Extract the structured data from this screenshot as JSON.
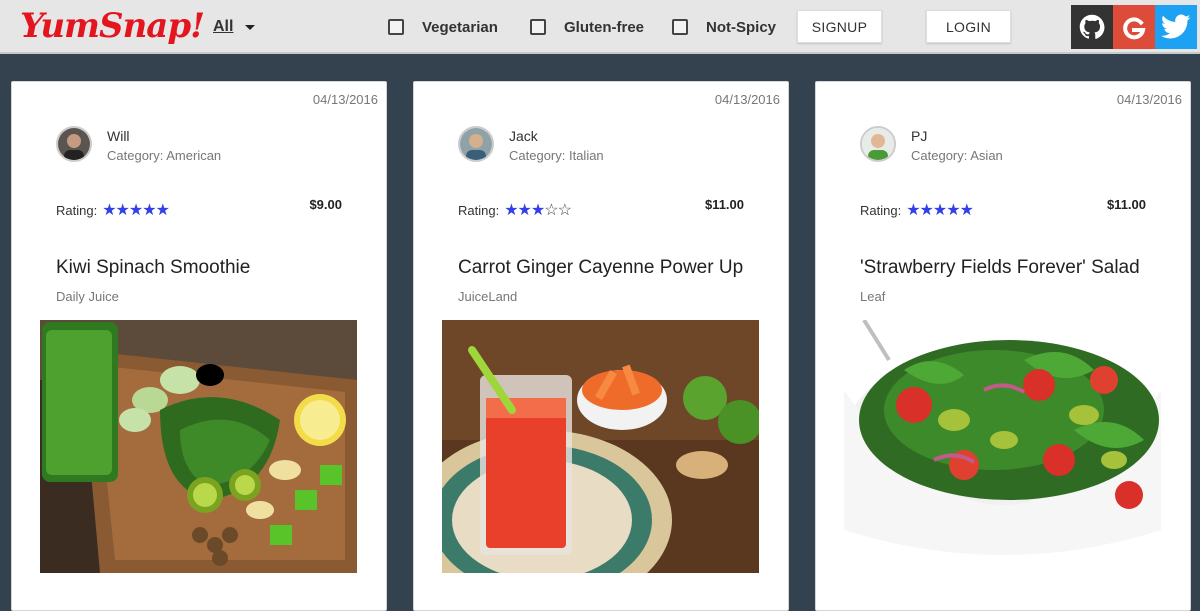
{
  "nav": {
    "logo": "YumSnap!",
    "filter_value": "All",
    "checkboxes": [
      "Vegetarian",
      "Gluten-free",
      "Not-Spicy"
    ],
    "signup_label": "SIGNUP",
    "login_label": "LOGIN",
    "social": [
      "github-icon",
      "google-icon",
      "twitter-icon"
    ]
  },
  "colors": {
    "brand_red": "#e3161f",
    "star_blue": "#3340e8",
    "page_bg": "#34424f"
  },
  "cards": [
    {
      "date": "04/13/2016",
      "user": "Will",
      "category": "Category: American",
      "rating_label": "Rating:",
      "rating": 5,
      "price": "$9.00",
      "title": "Kiwi Spinach Smoothie",
      "vendor": "Daily Juice"
    },
    {
      "date": "04/13/2016",
      "user": "Jack",
      "category": "Category: Italian",
      "rating_label": "Rating:",
      "rating": 3,
      "price": "$11.00",
      "title": "Carrot Ginger Cayenne Power Up",
      "vendor": "JuiceLand"
    },
    {
      "date": "04/13/2016",
      "user": "PJ",
      "category": "Category: Asian",
      "rating_label": "Rating:",
      "rating": 5,
      "price": "$11.00",
      "title": "'Strawberry Fields Forever' Salad",
      "vendor": "Leaf"
    }
  ]
}
